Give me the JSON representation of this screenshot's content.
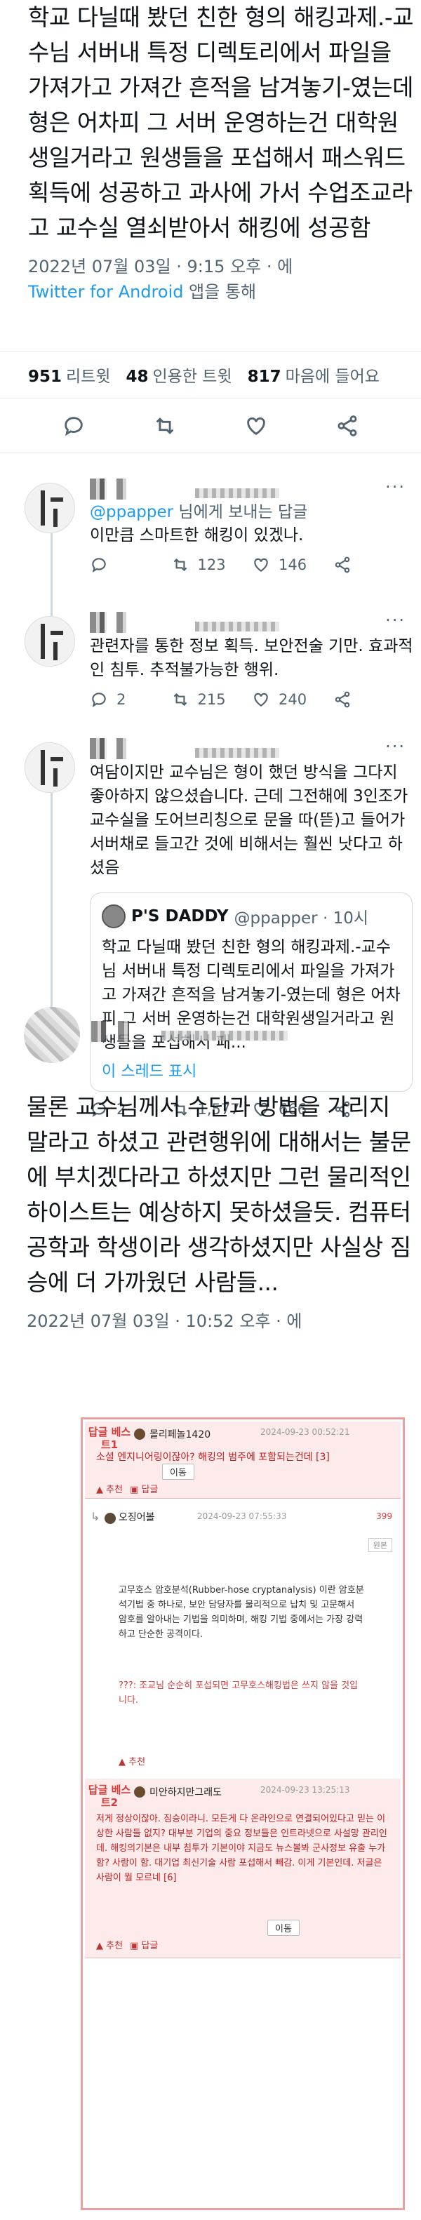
{
  "main_tweet": {
    "text": "학교 다닐때 봤던 친한 형의 해킹과제.-교수님 서버내 특정 디렉토리에서 파일을 가져가고 가져간 흔적을 남겨놓기-였는데 형은 어차피 그 서버 운영하는건 대학원생일거라고 원생들을 포섭해서 패스워드 획득에 성공하고 과사에 가서 수업조교라고 교수실 열쇠받아서 해킹에 성공함",
    "datetime": "2022년 07월 03일 · 9:15 오후 · 에",
    "client": "Twitter for Android",
    "client_suffix": "앱을 통해",
    "stats": {
      "retweets": "951",
      "retweets_label": "리트윗",
      "quotes": "48",
      "quotes_label": "인용한 트윗",
      "likes": "817",
      "likes_label": "마음에 들어요"
    }
  },
  "replies": [
    {
      "reply_to_handle": "@ppapper",
      "reply_to_suffix": "님에게 보내는 답글",
      "text": "이만큼 스마트한 해킹이 있겠나.",
      "reply_count": "",
      "retweet_count": "123",
      "like_count": "146"
    },
    {
      "text": "관련자를 통한 정보 획득. 보안전술 기만. 효과적인 침투. 추적불가능한 행위.",
      "reply_count": "2",
      "retweet_count": "215",
      "like_count": "240"
    },
    {
      "text": "여담이지만 교수님은 형이 했던 방식을 그다지 좋아하지 않으셨습니다. 근데 그전해에 3인조가 교수실을 도어브리칭으로 문을 따(뜯)고 들어가 서버채로 들고간 것에 비해서는 훨씬 낫다고 하셨음",
      "quote": {
        "name": "P'S DADDY",
        "handle": "@ppapper · 10시",
        "text": "학교 다닐때 봤던 친한 형의 해킹과제.-교수님 서버내 특정 디렉토리에서 파일을 가져가고 가져간 흔적을 남겨놓기-였는데 형은 어차피 그 서버 운영하는건 대학원생일거라고 원생들을 포섭해서 패...",
        "show_thread": "이 스레드 표시"
      },
      "reply_count": "2",
      "retweet_count": "1,577",
      "like_count": "666"
    }
  ],
  "final_tweet": {
    "text": "물론 교수님께서 수단과 방법을 가리지 말라고 하셨고 관련행위에 대해서는 불문에 부치겠다라고 하셨지만 그런 물리적인 하이스트는 예상하지 못하셨을듯. 컴퓨터공학과 학생이라 생각하셨지만 사실상 짐승에 더 가까웠던 사람들...",
    "datetime": "2022년 07월 03일 · 10:52 오후 · 에"
  },
  "comments": {
    "best1": {
      "label": "답글 베스트1",
      "name": "몰리페놀1420",
      "date": "2024-09-23 00:52:21",
      "text": "소셜 엔지니어링이잖아? 해킹의 범주에 포함되는건데 [3]",
      "move_label": "이동",
      "recommend_label": "추천",
      "reply_label": "답글"
    },
    "sub": {
      "name": "오징어볼",
      "date": "2024-09-23 07:55:33",
      "count": "399",
      "button": "원본",
      "body": "고무호스 암호분석(Rubber-hose cryptanalysis) 이란 암호분석기법 중 하나로, 보안 담당자를 물리적으로 납치 및 고문해서 암호를 알아내는 기법을 의미하며, 해킹 기법 중에서는 가장 강력하고 단순한 공격이다.",
      "red": "???: 조교님 순순히 포섭되면 고무호스해킹법은 쓰지 않을 것입니다.",
      "recommend_label": "추천"
    },
    "best2": {
      "label": "답글 베스트2",
      "name": "미안하지만그래도",
      "date": "2024-09-23 13:25:13",
      "text": "저게 정상이잖아. 짐승이라니. 모든게 다 온라인으로 연결되어있다고 믿는 이상한 사람들 없지? 대부분 기업의 중요 정보들은 인트라넷으로 사설망 관리인데. 해킹의기본은 내부 침투가 기본이야 지금도 뉴스볼봐 군사정보 유출 누가함? 사람이 함. 대기업 최신기술 사람 포섭해서 빼감. 이게 기본인데. 저글은 사람이 뭘 모르네 [6]",
      "move_label": "이동",
      "recommend_label": "추천",
      "reply_label": "답글"
    }
  },
  "colors": {
    "link": "#1d9bf0",
    "muted": "#536471",
    "accent_red": "#d43b3b",
    "board_border": "#e8a0a0"
  }
}
